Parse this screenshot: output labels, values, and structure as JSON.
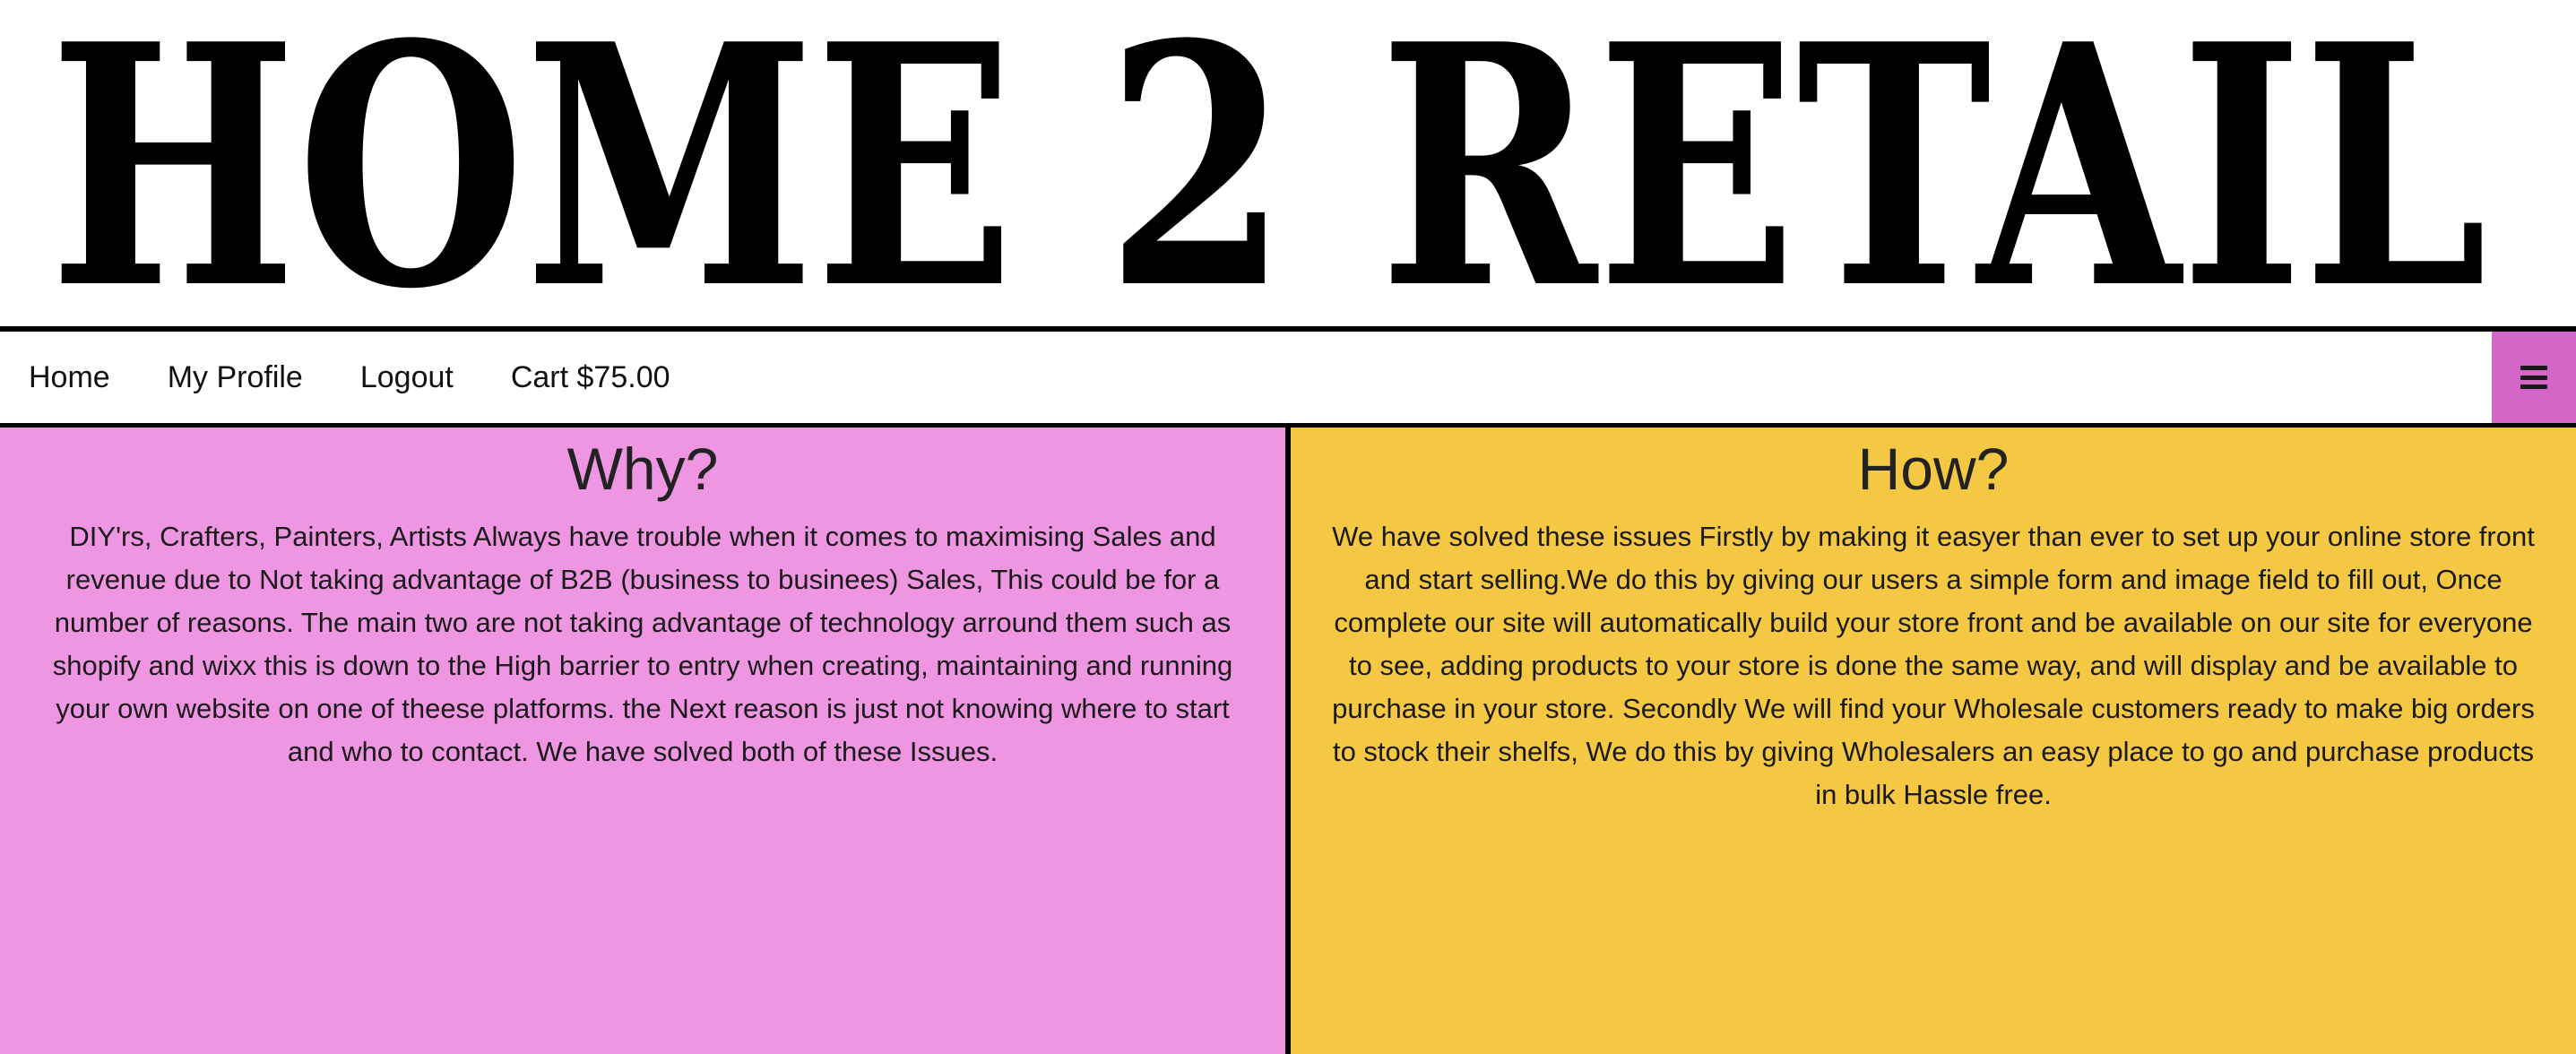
{
  "site": {
    "title": "HOME 2 RETAIL"
  },
  "nav": {
    "items": [
      {
        "label": "Home"
      },
      {
        "label": "My Profile"
      },
      {
        "label": "Logout"
      },
      {
        "label": "Cart $75.00"
      }
    ],
    "menu_toggle_icon": "hamburger-menu-icon"
  },
  "panels": {
    "why": {
      "heading": "Why?",
      "body": "DIY'rs, Crafters, Painters, Artists Always have trouble when it comes to maximising Sales and revenue due to Not taking advantage of B2B (business to businees) Sales, This could be for a number of reasons. The main two are not taking advantage of technology arround them such as shopify and wixx this is down to the High barrier to entry when creating, maintaining and running your own website on one of theese platforms. the Next reason is just not knowing where to start and who to contact. We have solved both of these Issues."
    },
    "how": {
      "heading": "How?",
      "body": "We have solved these issues Firstly by making it easyer than ever to set up your online store front and start selling.We do this by giving our users a simple form and image field to fill out, Once complete our site will automatically build your store front and be available on our site for everyone to see, adding products to your store is done the same way, and will display and be available to purchase in your store. Secondly We will find your Wholesale customers ready to make big orders to stock their shelfs, We do this by giving Wholesalers an easy place to go and purchase products in bulk Hassle free."
    }
  },
  "colors": {
    "why_background": "#ee96e2",
    "how_background": "#f5c843",
    "menu_toggle_background": "#d466c8",
    "rules": "#000000"
  }
}
